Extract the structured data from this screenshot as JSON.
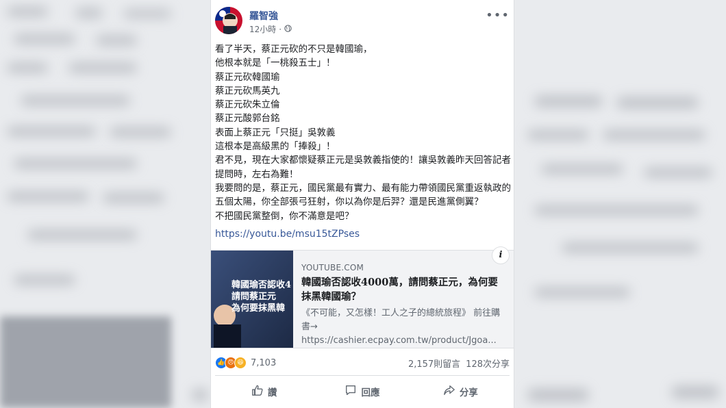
{
  "post": {
    "author": "羅智強",
    "time": "12小時",
    "separator": "·",
    "privacy_icon": "globe-icon",
    "more_label": "•••",
    "lines": [
      "看了半天，蔡正元砍的不只是韓國瑜，",
      "他根本就是「一桃殺五士」！",
      "蔡正元砍韓國瑜",
      "蔡正元砍馬英九",
      "蔡正元砍朱立倫",
      "蔡正元酸郭台銘",
      "表面上蔡正元「只挺」吳敦義",
      "這根本是高級黑的「捧殺」！",
      "君不見，現在大家都懷疑蔡正元是吳敦義指使的！讓吳敦義昨天回答記者提問時，左右為難！",
      "我要問的是，蔡正元，國民黨最有實力、最有能力帶領國民黨重返執政的五個太陽，你全部張弓狂射，你以為你是后羿？還是民進黨側翼？",
      "不把國民黨整倒，你不滿意是吧？"
    ],
    "link": "https://youtu.be/msu15tZPses"
  },
  "preview": {
    "domain": "YOUTUBE.COM",
    "title": "韓國瑜否認收4000萬，請問蔡正元，為何要抹黑韓國瑜？",
    "description": "《不可能，又怎樣！工人之子的總統旅程》 前往購書→ https://cashier.ecpay.com.tw/product/Jgoa...",
    "info_label": "i",
    "thumb_text": [
      "韓國瑜否認收4",
      "請問蔡正元",
      "為何要抹黑韓"
    ]
  },
  "stats": {
    "reactions": "7,103",
    "comments": "2,157則留言",
    "shares": "128次分享"
  },
  "actions": {
    "like": "讚",
    "comment": "回應",
    "share": "分享"
  },
  "colors": {
    "link": "#385898",
    "like_blue": "#1877f2",
    "haha_yellow": "#f7b125",
    "angry_red": "#e9710f"
  }
}
